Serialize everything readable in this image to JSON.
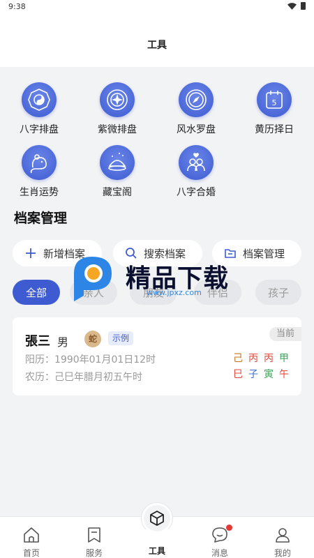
{
  "status": {
    "time": "9:38"
  },
  "header": {
    "title": "工具"
  },
  "tools": [
    {
      "label": "八字排盘",
      "icon": "bagua-icon"
    },
    {
      "label": "紫微排盘",
      "icon": "compass-star-icon"
    },
    {
      "label": "风水罗盘",
      "icon": "compass-icon"
    },
    {
      "label": "黄历择日",
      "icon": "calendar-icon",
      "badge": "5"
    },
    {
      "label": "生肖运势",
      "icon": "rat-icon"
    },
    {
      "label": "藏宝阁",
      "icon": "treasure-icon"
    },
    {
      "label": "八字合婚",
      "icon": "couple-icon"
    }
  ],
  "archive": {
    "title": "档案管理",
    "actions": [
      {
        "label": "新增档案",
        "icon": "plus-icon"
      },
      {
        "label": "搜索档案",
        "icon": "search-icon"
      },
      {
        "label": "档案管理",
        "icon": "folder-icon"
      }
    ],
    "filters": [
      "全部",
      "亲人",
      "朋友",
      "伴侣",
      "孩子"
    ],
    "active_filter": "全部"
  },
  "record": {
    "name": "張三",
    "gender": "男",
    "zodiac": "蛇",
    "tag": "示例",
    "current": "当前",
    "solar": "阳历：1990年01月01日12时",
    "lunar": "农历：己巳年腊月初五午时",
    "bazi_top": [
      "己",
      "丙",
      "丙",
      "甲"
    ],
    "bazi_bottom": [
      "巳",
      "子",
      "寅",
      "午"
    ],
    "bazi_top_colors": [
      "#c7741f",
      "#e5483b",
      "#e5483b",
      "#3aa35a"
    ],
    "bazi_bottom_colors": [
      "#e5483b",
      "#3a6fd8",
      "#3aa35a",
      "#e5483b"
    ]
  },
  "tabbar": [
    {
      "label": "首页",
      "icon": "home-icon"
    },
    {
      "label": "服务",
      "icon": "bookmark-icon"
    },
    {
      "label": "工具",
      "icon": "cube-icon"
    },
    {
      "label": "消息",
      "icon": "chat-icon"
    },
    {
      "label": "我的",
      "icon": "user-icon"
    }
  ],
  "watermark": {
    "brand": "精品下载",
    "site": "www.jpxz.com"
  },
  "colors": {
    "accent": "#3e5bd2",
    "bg": "#f2f3f5"
  }
}
